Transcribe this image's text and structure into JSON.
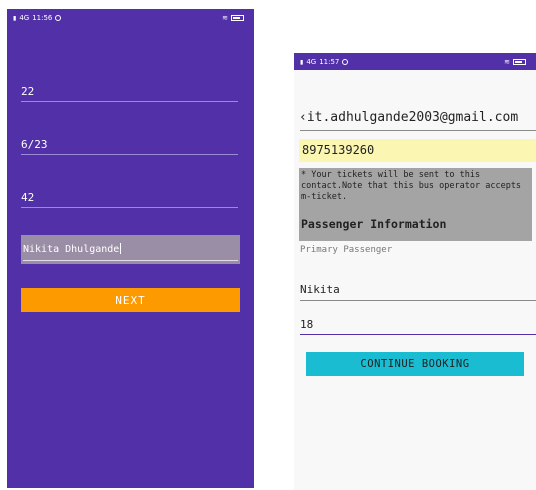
{
  "left_screen": {
    "status": {
      "time": "11:56",
      "net": "4G"
    },
    "fields": [
      {
        "value": "22"
      },
      {
        "value": "6/23"
      },
      {
        "value": "42"
      }
    ],
    "name_value": "Nikita Dhulgande",
    "next_label": "NEXT"
  },
  "right_screen": {
    "status": {
      "time": "11:57",
      "net": "4G"
    },
    "email": "‹it.adhulgande2003@gmail.com",
    "phone": "8975139260",
    "ticket_note": "* Your tickets will be sent to this contact.Note that this bus operator accepts m-ticket.",
    "passenger_heading": "Passenger Information",
    "primary_label": "Primary Passenger",
    "first_name": "Nikita",
    "age": "18",
    "continue_label": "CONTINUE BOOKING"
  },
  "colors": {
    "purple": "#5130a8",
    "orange": "#fd9a00",
    "cyan": "#19bcd0",
    "yellow_field": "#fbf7b3",
    "gray_box": "#a4a4a4"
  },
  "icons": [
    "signal-icon",
    "sync-icon",
    "wifi-icon",
    "battery-icon"
  ]
}
